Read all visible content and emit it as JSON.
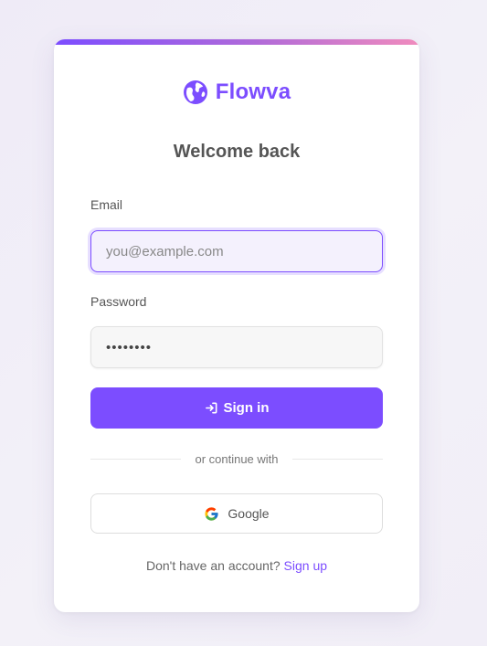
{
  "brand": {
    "name": "Flowva",
    "icon": "globe-icon",
    "color": "#7c4dff"
  },
  "form": {
    "heading": "Welcome back",
    "email": {
      "label": "Email",
      "placeholder": "you@example.com",
      "value": ""
    },
    "password": {
      "label": "Password",
      "value": "••••••••"
    },
    "submit": {
      "label": "Sign in",
      "icon": "sign-in-icon"
    }
  },
  "divider": {
    "text": "or continue with"
  },
  "social": {
    "google": {
      "label": "Google",
      "icon": "google-icon"
    }
  },
  "footer": {
    "prompt": "Don't have an account?",
    "link_label": "Sign up"
  },
  "colors": {
    "accent": "#7c4dff",
    "accent_gradient_end": "#f08bbd",
    "background": "#f1eef8"
  }
}
